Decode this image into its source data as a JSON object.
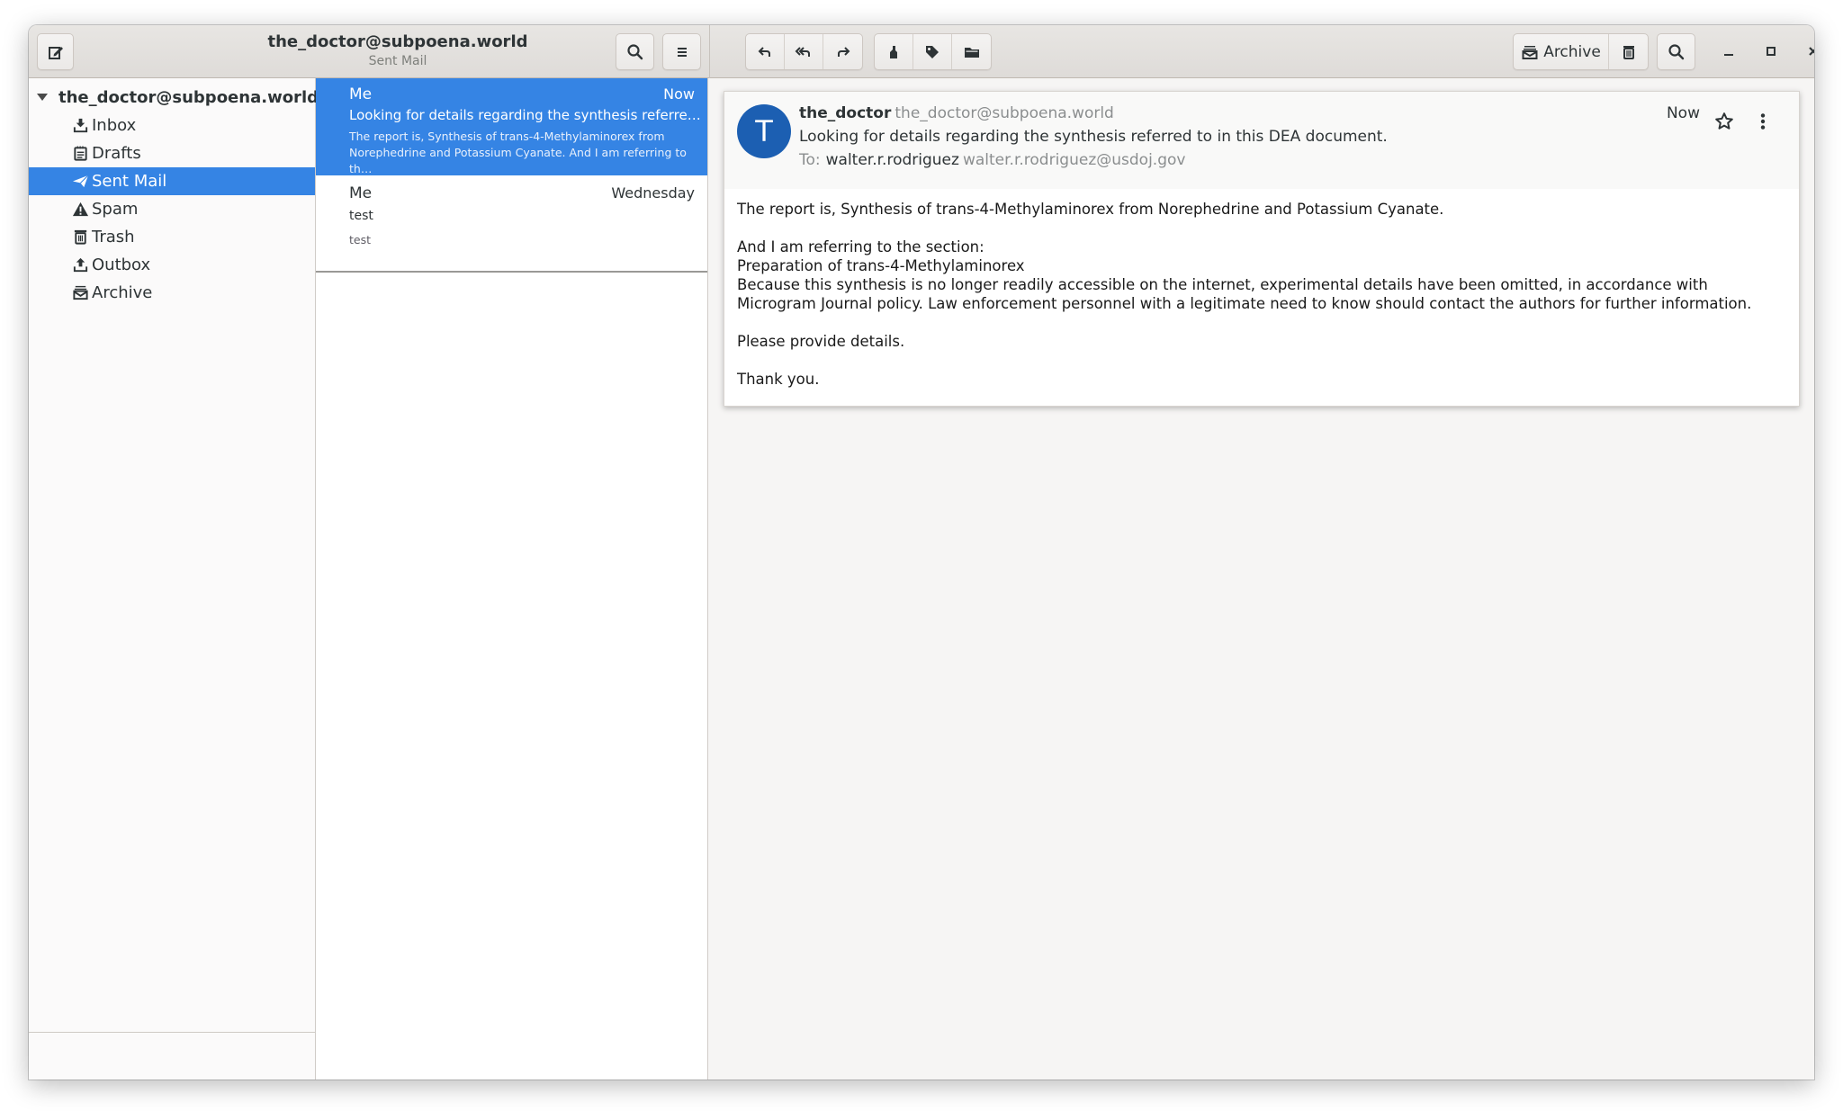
{
  "header": {
    "account_title": "the_doctor@subpoena.world",
    "folder_subtitle": "Sent Mail",
    "compose_icon": "compose-icon",
    "search_icon": "search-icon",
    "menu_icon": "hamburger-menu-icon",
    "actions": {
      "reply_icon": "reply-icon",
      "reply_all_icon": "reply-all-icon",
      "forward_icon": "forward-icon",
      "mark_icon": "highlighter-mark-icon",
      "label_icon": "tag-icon",
      "move_icon": "folder-icon"
    },
    "archive_label": "Archive",
    "archive_icon": "archive-icon",
    "trash_icon": "trash-icon",
    "find_icon": "search-icon",
    "window_controls": [
      "minimize",
      "maximize",
      "close"
    ]
  },
  "sidebar": {
    "account": "the_doctor@subpoena.world",
    "folders": [
      {
        "label": "Inbox",
        "icon": "inbox-download-icon",
        "selected": false
      },
      {
        "label": "Drafts",
        "icon": "drafts-notepad-icon",
        "selected": false
      },
      {
        "label": "Sent Mail",
        "icon": "paper-plane-icon",
        "selected": true
      },
      {
        "label": "Spam",
        "icon": "warning-triangle-icon",
        "selected": false
      },
      {
        "label": "Trash",
        "icon": "trash-icon",
        "selected": false
      },
      {
        "label": "Outbox",
        "icon": "outbox-upload-icon",
        "selected": false
      },
      {
        "label": "Archive",
        "icon": "archive-icon",
        "selected": false
      }
    ]
  },
  "message_list": [
    {
      "from": "Me",
      "date": "Now",
      "subject": "Looking for details regarding the synthesis referred to in this DEA document.",
      "preview": "The report is, Synthesis of trans-4-Methylaminorex from Norephedrine and Potassium Cyanate. And I am referring to th…",
      "selected": true
    },
    {
      "from": "Me",
      "date": "Wednesday",
      "subject": "test",
      "preview": "test",
      "selected": false
    }
  ],
  "reader": {
    "avatar_initial": "T",
    "sender_name": "the_doctor",
    "sender_email": "the_doctor@subpoena.world",
    "subject": "Looking for details regarding the synthesis referred to in this DEA document.",
    "to_label": "To:",
    "to_name": "walter.r.rodriguez",
    "to_email": "walter.r.rodriguez@usdoj.gov",
    "date": "Now",
    "accent_color": "#1c5fb2",
    "body": {
      "p1": "The report is, Synthesis of trans-4-Methylaminorex from Norephedrine and Potassium Cyanate.",
      "p2_line1": "And I am referring to the section:",
      "p2_line2": "Preparation of trans-4-Methylaminorex",
      "p2_line3": "Because this synthesis is no longer readily accessible on the internet, experimental details have been omitted, in accordance with Microgram Journal policy. Law enforcement personnel with a legitimate need to know should contact the authors for further information.",
      "p3": "Please provide details.",
      "p4": "Thank you."
    }
  },
  "colors": {
    "selection": "#3584e4",
    "avatar": "#1c5fb2"
  }
}
